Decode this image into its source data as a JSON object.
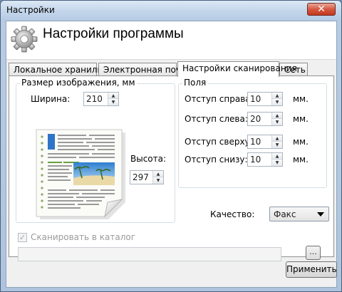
{
  "window": {
    "title": "Настройки",
    "close_glyph": "✕"
  },
  "header": {
    "icon": "gear-icon",
    "title": "Настройки программы"
  },
  "tabs": [
    {
      "label": "Локальное хранилище",
      "active": false
    },
    {
      "label": "Электронная почта",
      "active": false
    },
    {
      "label": "Настройки сканирования",
      "active": true
    },
    {
      "label": "Сеть",
      "active": false
    }
  ],
  "image_size": {
    "legend": "Размер изображения, мм",
    "width_label": "Ширина:",
    "width_value": "210",
    "height_label": "Высота:",
    "height_value": "297",
    "preview_icon": "document-preview-icon"
  },
  "margins": {
    "legend": "Поля",
    "right_label": "Отступ справа:",
    "right_value": "10",
    "left_label": "Отступ слева:",
    "left_value": "20",
    "top_label": "Отступ сверху:",
    "top_value": "10",
    "bottom_label": "Отступ снизу:",
    "bottom_value": "10",
    "unit": "мм."
  },
  "quality": {
    "label": "Качество:",
    "value": "Факс"
  },
  "catalog": {
    "checkbox_label": "Сканировать в каталог",
    "checked": true,
    "enabled": false,
    "path_value": "",
    "browse_label": "..."
  },
  "footer": {
    "apply_label": "Применить"
  },
  "colors": {
    "title_bar": "#c2d5ea",
    "close_button": "#d6583f",
    "client_bg": "#f0f0f0",
    "panel_bg": "#ffffff",
    "group_border": "#d5dfe5"
  }
}
